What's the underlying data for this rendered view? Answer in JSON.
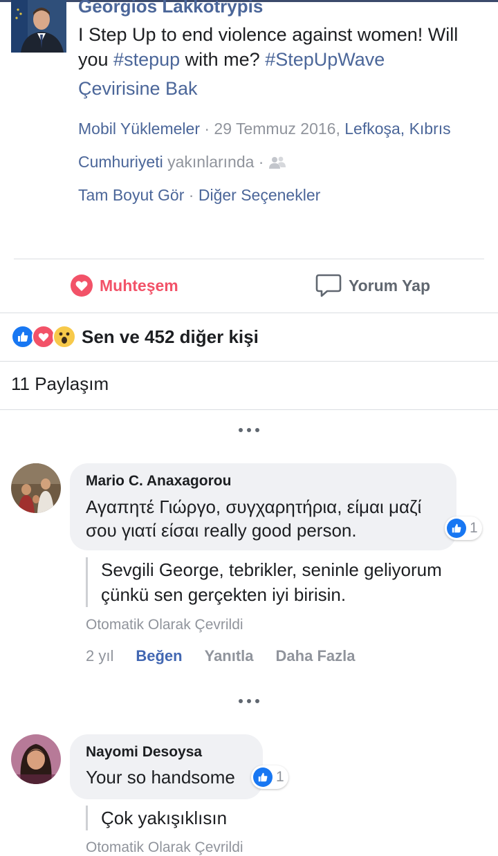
{
  "post": {
    "author": "Georgios Lakkotrypis",
    "text_part1": "I Step Up to end violence against women! Will you ",
    "hashtag1": "#stepup",
    "text_part2": " with me? ",
    "hashtag2": "#StepUpWave",
    "see_translation": "Çevirisine Bak",
    "meta": {
      "album": "Mobil Yüklemeler",
      "date": " · 29 Temmuz 2016, ",
      "location_line1": "Lefkoşa, Kıbrıs",
      "location_line2": "Cumhuriyeti",
      "near": " yakınlarında · ",
      "full_size": "Tam Boyut Gör",
      "separator": " · ",
      "more_options": "Diğer Seçenekler"
    }
  },
  "actions": {
    "like_label": "Muhteşem",
    "comment_label": "Yorum Yap"
  },
  "reactions": {
    "summary": "Sen ve 452 diğer kişi"
  },
  "shares": {
    "label": "11 Paylaşım"
  },
  "comments": [
    {
      "author": "Mario C. Anaxagorou",
      "text": "Αγαπητέ Γιώργο, συγχαρητήρια, είμαι μαζί σου γιατί είσαι really good person.",
      "likes": "1",
      "translation": "Sevgili George, tebrikler, seninle geliyorum çünkü sen gerçekten iyi birisin.",
      "auto_translated": "Otomatik Olarak Çevrildi",
      "time": "2 yıl",
      "like_action": "Beğen",
      "reply_action": "Yanıtla",
      "more_action": "Daha Fazla"
    },
    {
      "author": "Nayomi Desoysa",
      "text": "Your so handsome",
      "likes": "1",
      "translation": "Çok yakışıklısın",
      "auto_translated": "Otomatik Olarak Çevrildi"
    }
  ],
  "colors": {
    "link": "#4b6699",
    "love": "#f25268",
    "like_blue": "#1877f2",
    "meta_gray": "#90949c"
  },
  "icons": [
    "heart-icon",
    "comment-icon",
    "like-reaction-icon",
    "love-reaction-icon",
    "wow-reaction-icon",
    "friends-audience-icon",
    "more-dots-icon"
  ]
}
